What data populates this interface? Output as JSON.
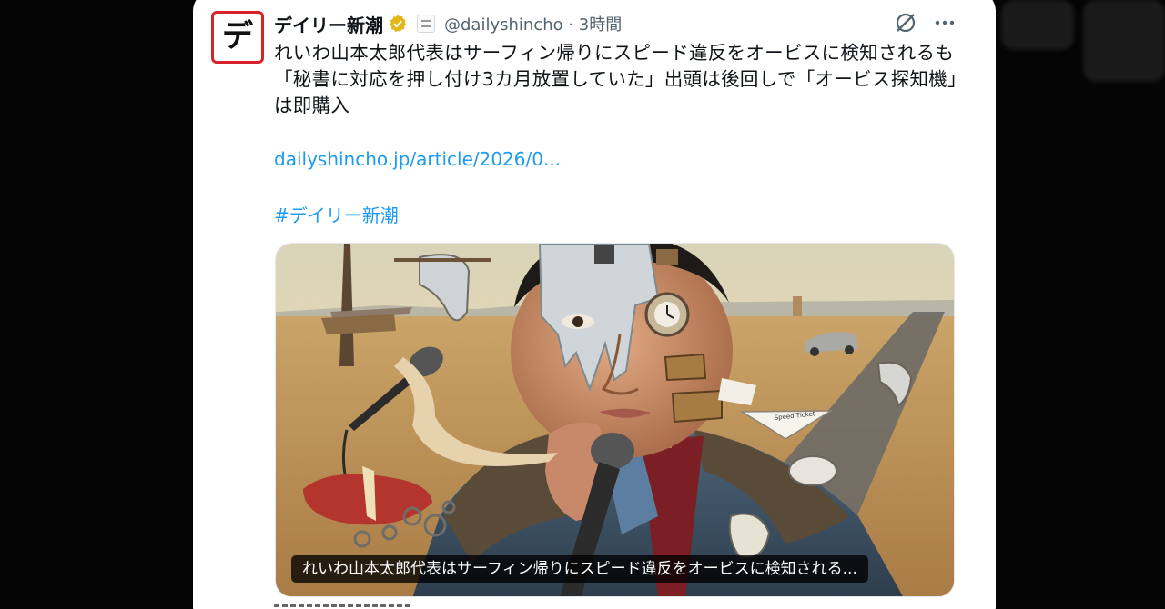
{
  "tweet": {
    "author_name": "デイリー新潮",
    "avatar_glyph": "デ",
    "handle_time": "@dailyshincho · 3時間",
    "text": "れいわ山本太郎代表はサーフィン帰りにスピード違反をオービスに検知されるも「秘書に対応を押し付け3カ月放置していた」出頭は後回しで「オービス探知機」は即購入",
    "link": "dailyshincho.jp/article/2026/0...",
    "hashtag": "#デイリー新潮",
    "media_caption": "れいわ山本太郎代表はサーフィン帰りにスピード違反をオービスに検知される...",
    "ticket_text": "Speed Ticket"
  },
  "icons": {
    "verified": "verified-badge-icon",
    "affiliate": "affiliate-badge-icon",
    "grok": "grok-icon",
    "more": "more-icon"
  },
  "colors": {
    "link": "#1d9bf0",
    "verified": "#e2b719",
    "avatar_border": "#d8232a"
  }
}
